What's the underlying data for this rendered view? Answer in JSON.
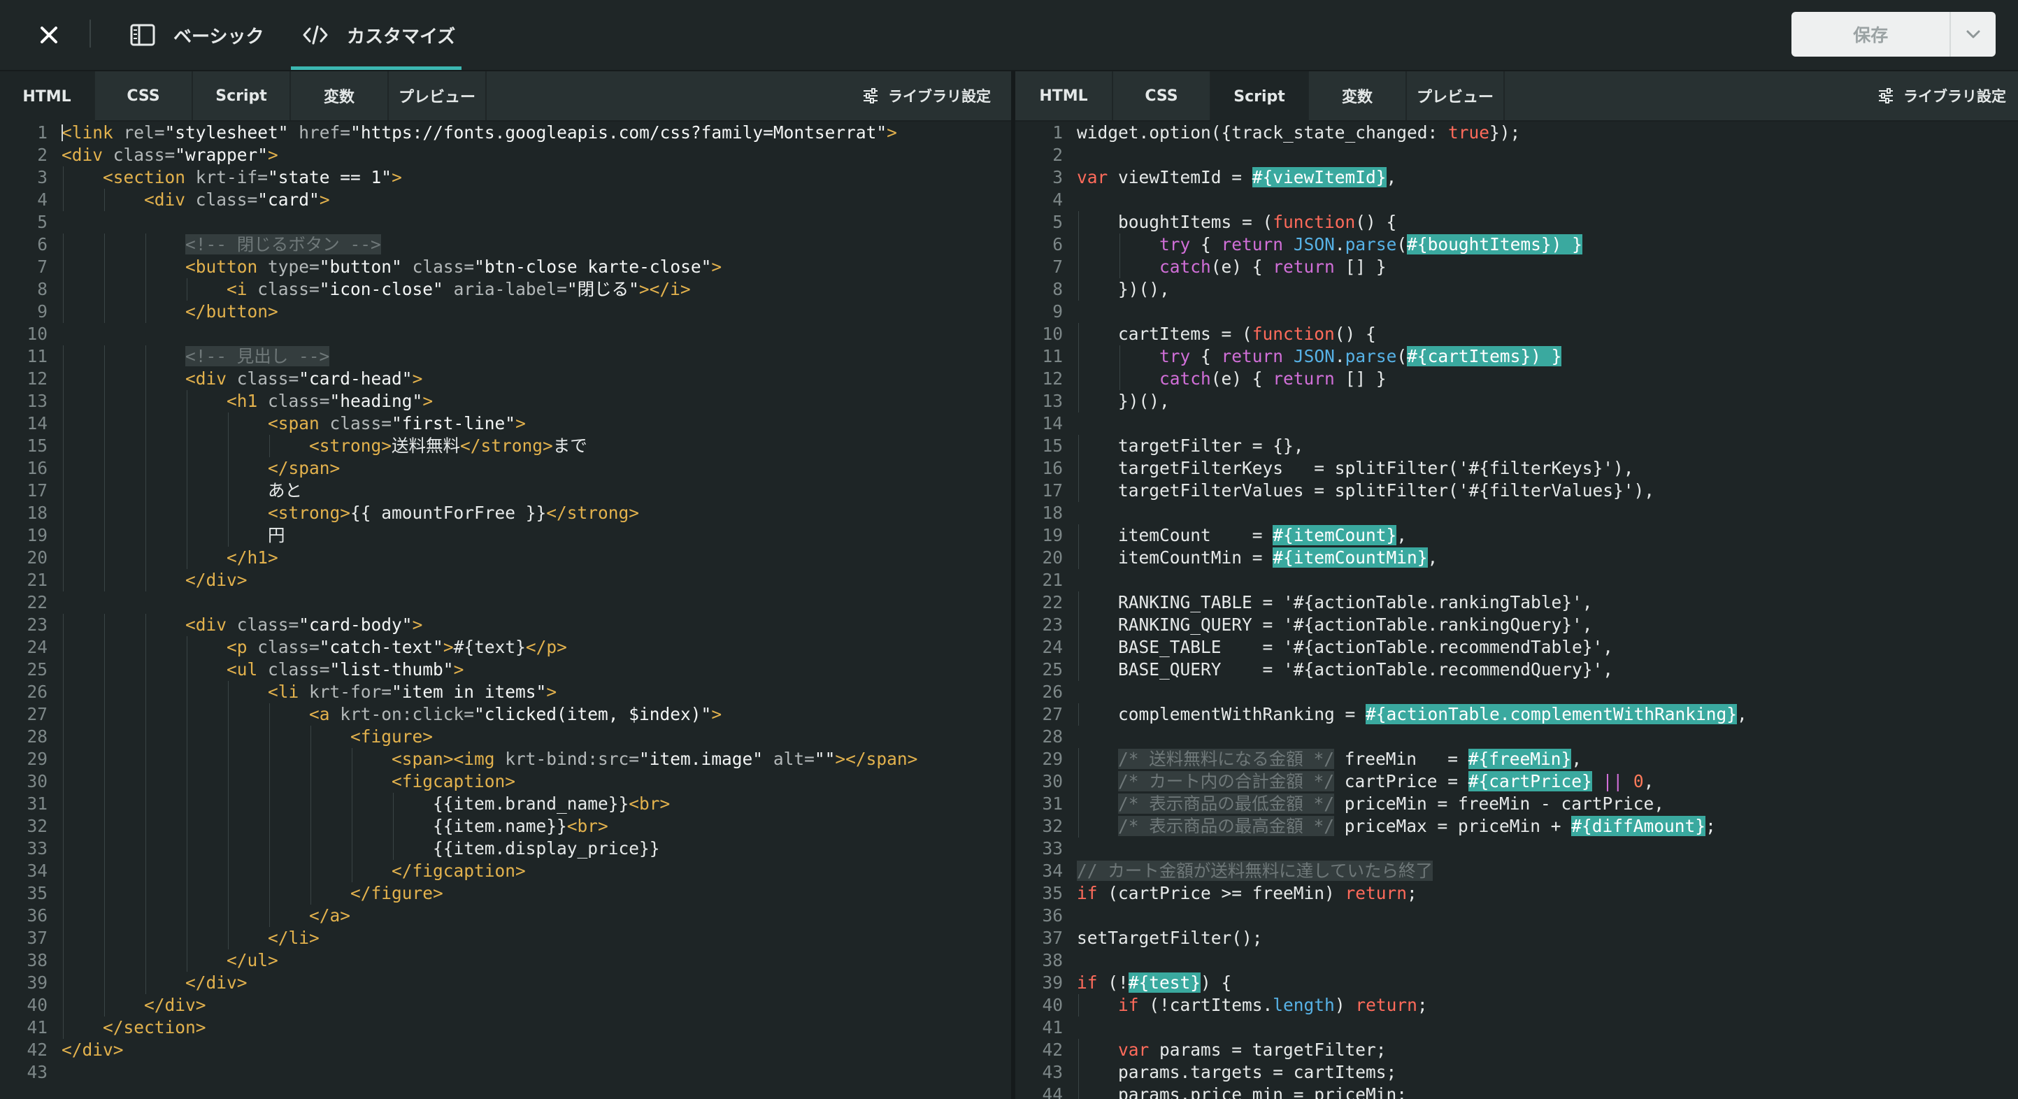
{
  "topbar": {
    "tab_basic": "ベーシック",
    "tab_customize": "カスタマイズ",
    "save_label": "保存"
  },
  "left_pane": {
    "tabs": [
      "HTML",
      "CSS",
      "Script",
      "変数",
      "プレビュー"
    ],
    "active_tab": "HTML",
    "library_label": "ライブラリ設定",
    "lines": [
      [
        [
          "t",
          "<link "
        ],
        [
          "a",
          "rel="
        ],
        [
          "s",
          "\"stylesheet\" "
        ],
        [
          "a",
          "href="
        ],
        [
          "s",
          "\"https://fonts.googleapis.com/css?family=Montserrat\""
        ],
        [
          "t",
          ">"
        ]
      ],
      [
        [
          "t",
          "<div "
        ],
        [
          "a",
          "class="
        ],
        [
          "s",
          "\"wrapper\""
        ],
        [
          "t",
          ">"
        ]
      ],
      [
        [
          "p",
          "    "
        ],
        [
          "t",
          "<section "
        ],
        [
          "a",
          "krt-if="
        ],
        [
          "s",
          "\"state == 1\""
        ],
        [
          "t",
          ">"
        ]
      ],
      [
        [
          "p",
          "        "
        ],
        [
          "t",
          "<div "
        ],
        [
          "a",
          "class="
        ],
        [
          "s",
          "\"card\""
        ],
        [
          "t",
          ">"
        ]
      ],
      [],
      [
        [
          "p",
          "            "
        ],
        [
          "c",
          "<!-- 閉じるボタン -->"
        ]
      ],
      [
        [
          "p",
          "            "
        ],
        [
          "t",
          "<button "
        ],
        [
          "a",
          "type="
        ],
        [
          "s",
          "\"button\" "
        ],
        [
          "a",
          "class="
        ],
        [
          "s",
          "\"btn-close karte-close\""
        ],
        [
          "t",
          ">"
        ]
      ],
      [
        [
          "p",
          "                "
        ],
        [
          "t",
          "<i "
        ],
        [
          "a",
          "class="
        ],
        [
          "s",
          "\"icon-close\" "
        ],
        [
          "a",
          "aria-label="
        ],
        [
          "s",
          "\"閉じる\""
        ],
        [
          "t",
          "></i>"
        ]
      ],
      [
        [
          "p",
          "            "
        ],
        [
          "t",
          "</button>"
        ]
      ],
      [],
      [
        [
          "p",
          "            "
        ],
        [
          "c",
          "<!-- 見出し -->"
        ]
      ],
      [
        [
          "p",
          "            "
        ],
        [
          "t",
          "<div "
        ],
        [
          "a",
          "class="
        ],
        [
          "s",
          "\"card-head\""
        ],
        [
          "t",
          ">"
        ]
      ],
      [
        [
          "p",
          "                "
        ],
        [
          "t",
          "<h1 "
        ],
        [
          "a",
          "class="
        ],
        [
          "s",
          "\"heading\""
        ],
        [
          "t",
          ">"
        ]
      ],
      [
        [
          "p",
          "                    "
        ],
        [
          "t",
          "<span "
        ],
        [
          "a",
          "class="
        ],
        [
          "s",
          "\"first-line\""
        ],
        [
          "t",
          ">"
        ]
      ],
      [
        [
          "p",
          "                        "
        ],
        [
          "t",
          "<strong>"
        ],
        [
          "n",
          "送料無料"
        ],
        [
          "t",
          "</strong>"
        ],
        [
          "n",
          "まで"
        ]
      ],
      [
        [
          "p",
          "                    "
        ],
        [
          "t",
          "</span>"
        ]
      ],
      [
        [
          "p",
          "                    "
        ],
        [
          "n",
          "あと"
        ]
      ],
      [
        [
          "p",
          "                    "
        ],
        [
          "t",
          "<strong>"
        ],
        [
          "n",
          "{{ amountForFree }}"
        ],
        [
          "t",
          "</strong>"
        ]
      ],
      [
        [
          "p",
          "                    "
        ],
        [
          "n",
          "円"
        ]
      ],
      [
        [
          "p",
          "                "
        ],
        [
          "t",
          "</h1>"
        ]
      ],
      [
        [
          "p",
          "            "
        ],
        [
          "t",
          "</div>"
        ]
      ],
      [],
      [
        [
          "p",
          "            "
        ],
        [
          "t",
          "<div "
        ],
        [
          "a",
          "class="
        ],
        [
          "s",
          "\"card-body\""
        ],
        [
          "t",
          ">"
        ]
      ],
      [
        [
          "p",
          "                "
        ],
        [
          "t",
          "<p "
        ],
        [
          "a",
          "class="
        ],
        [
          "s",
          "\"catch-text\""
        ],
        [
          "t",
          ">"
        ],
        [
          "n",
          "#{text}"
        ],
        [
          "t",
          "</p>"
        ]
      ],
      [
        [
          "p",
          "                "
        ],
        [
          "t",
          "<ul "
        ],
        [
          "a",
          "class="
        ],
        [
          "s",
          "\"list-thumb\""
        ],
        [
          "t",
          ">"
        ]
      ],
      [
        [
          "p",
          "                    "
        ],
        [
          "t",
          "<li "
        ],
        [
          "a",
          "krt-for="
        ],
        [
          "s",
          "\"item in items\""
        ],
        [
          "t",
          ">"
        ]
      ],
      [
        [
          "p",
          "                        "
        ],
        [
          "t",
          "<a "
        ],
        [
          "a",
          "krt-on:click="
        ],
        [
          "s",
          "\"clicked(item, $index)\""
        ],
        [
          "t",
          ">"
        ]
      ],
      [
        [
          "p",
          "                            "
        ],
        [
          "t",
          "<figure>"
        ]
      ],
      [
        [
          "p",
          "                                "
        ],
        [
          "t",
          "<span><img "
        ],
        [
          "a",
          "krt-bind:src="
        ],
        [
          "s",
          "\"item.image\" "
        ],
        [
          "a",
          "alt="
        ],
        [
          "s",
          "\"\""
        ],
        [
          "t",
          "></span>"
        ]
      ],
      [
        [
          "p",
          "                                "
        ],
        [
          "t",
          "<figcaption>"
        ]
      ],
      [
        [
          "p",
          "                                    "
        ],
        [
          "n",
          "{{item.brand_name}}"
        ],
        [
          "t",
          "<br>"
        ]
      ],
      [
        [
          "p",
          "                                    "
        ],
        [
          "n",
          "{{item.name}}"
        ],
        [
          "t",
          "<br>"
        ]
      ],
      [
        [
          "p",
          "                                    "
        ],
        [
          "n",
          "{{item.display_price}}"
        ]
      ],
      [
        [
          "p",
          "                                "
        ],
        [
          "t",
          "</figcaption>"
        ]
      ],
      [
        [
          "p",
          "                            "
        ],
        [
          "t",
          "</figure>"
        ]
      ],
      [
        [
          "p",
          "                        "
        ],
        [
          "t",
          "</a>"
        ]
      ],
      [
        [
          "p",
          "                    "
        ],
        [
          "t",
          "</li>"
        ]
      ],
      [
        [
          "p",
          "                "
        ],
        [
          "t",
          "</ul>"
        ]
      ],
      [
        [
          "p",
          "            "
        ],
        [
          "t",
          "</div>"
        ]
      ],
      [
        [
          "p",
          "        "
        ],
        [
          "t",
          "</div>"
        ]
      ],
      [
        [
          "p",
          "    "
        ],
        [
          "t",
          "</section>"
        ]
      ],
      [
        [
          "t",
          "</div>"
        ]
      ],
      []
    ]
  },
  "right_pane": {
    "tabs": [
      "HTML",
      "CSS",
      "Script",
      "変数",
      "プレビュー"
    ],
    "active_tab": "Script",
    "library_label": "ライブラリ設定",
    "lines": [
      [
        [
          "n",
          "widget.option({track_state_changed: "
        ],
        [
          "k",
          "true"
        ],
        [
          "n",
          "});"
        ]
      ],
      [],
      [
        [
          "k",
          "var "
        ],
        [
          "n",
          "viewItemId = "
        ],
        [
          "h",
          "#{viewItemId}"
        ],
        [
          "n",
          ","
        ]
      ],
      [],
      [
        [
          "p",
          "    "
        ],
        [
          "n",
          "boughtItems = ("
        ],
        [
          "k",
          "function"
        ],
        [
          "n",
          "() {"
        ]
      ],
      [
        [
          "p",
          "        "
        ],
        [
          "u",
          "try "
        ],
        [
          "n",
          "{ "
        ],
        [
          "u",
          "return "
        ],
        [
          "b",
          "JSON"
        ],
        [
          "n",
          "."
        ],
        [
          "b",
          "parse"
        ],
        [
          "n",
          "("
        ],
        [
          "h",
          "#{boughtItems}) }"
        ]
      ],
      [
        [
          "p",
          "        "
        ],
        [
          "u",
          "catch"
        ],
        [
          "n",
          "(e) { "
        ],
        [
          "u",
          "return "
        ],
        [
          "n",
          "[] }"
        ]
      ],
      [
        [
          "p",
          "    "
        ],
        [
          "n",
          "})(),"
        ]
      ],
      [],
      [
        [
          "p",
          "    "
        ],
        [
          "n",
          "cartItems = ("
        ],
        [
          "k",
          "function"
        ],
        [
          "n",
          "() {"
        ]
      ],
      [
        [
          "p",
          "        "
        ],
        [
          "u",
          "try "
        ],
        [
          "n",
          "{ "
        ],
        [
          "u",
          "return "
        ],
        [
          "b",
          "JSON"
        ],
        [
          "n",
          "."
        ],
        [
          "b",
          "parse"
        ],
        [
          "n",
          "("
        ],
        [
          "h",
          "#{cartItems}) }"
        ]
      ],
      [
        [
          "p",
          "        "
        ],
        [
          "u",
          "catch"
        ],
        [
          "n",
          "(e) { "
        ],
        [
          "u",
          "return "
        ],
        [
          "n",
          "[] }"
        ]
      ],
      [
        [
          "p",
          "    "
        ],
        [
          "n",
          "})(),"
        ]
      ],
      [],
      [
        [
          "p",
          "    "
        ],
        [
          "n",
          "targetFilter = {},"
        ]
      ],
      [
        [
          "p",
          "    "
        ],
        [
          "n",
          "targetFilterKeys   = splitFilter('#{filterKeys}'),"
        ]
      ],
      [
        [
          "p",
          "    "
        ],
        [
          "n",
          "targetFilterValues = splitFilter('#{filterValues}'),"
        ]
      ],
      [],
      [
        [
          "p",
          "    "
        ],
        [
          "n",
          "itemCount    = "
        ],
        [
          "h",
          "#{itemCount}"
        ],
        [
          "n",
          ","
        ]
      ],
      [
        [
          "p",
          "    "
        ],
        [
          "n",
          "itemCountMin = "
        ],
        [
          "h",
          "#{itemCountMin}"
        ],
        [
          "n",
          ","
        ]
      ],
      [],
      [
        [
          "p",
          "    "
        ],
        [
          "n",
          "RANKING_TABLE = '#{actionTable.rankingTable}',"
        ]
      ],
      [
        [
          "p",
          "    "
        ],
        [
          "n",
          "RANKING_QUERY = '#{actionTable.rankingQuery}',"
        ]
      ],
      [
        [
          "p",
          "    "
        ],
        [
          "n",
          "BASE_TABLE    = '#{actionTable.recommendTable}',"
        ]
      ],
      [
        [
          "p",
          "    "
        ],
        [
          "n",
          "BASE_QUERY    = '#{actionTable.recommendQuery}',"
        ]
      ],
      [],
      [
        [
          "p",
          "    "
        ],
        [
          "n",
          "complementWithRanking = "
        ],
        [
          "h",
          "#{actionTable.complementWithRanking}"
        ],
        [
          "n",
          ","
        ]
      ],
      [],
      [
        [
          "p",
          "    "
        ],
        [
          "c",
          "/* 送料無料になる金額 */"
        ],
        [
          "n",
          " freeMin   = "
        ],
        [
          "h",
          "#{freeMin}"
        ],
        [
          "n",
          ","
        ]
      ],
      [
        [
          "p",
          "    "
        ],
        [
          "c",
          "/* カート内の合計金額 */"
        ],
        [
          "n",
          " cartPrice = "
        ],
        [
          "h",
          "#{cartPrice}"
        ],
        [
          "n",
          " "
        ],
        [
          "u",
          "||"
        ],
        [
          "n",
          " "
        ],
        [
          "m",
          "0"
        ],
        [
          "n",
          ","
        ]
      ],
      [
        [
          "p",
          "    "
        ],
        [
          "c",
          "/* 表示商品の最低金額 */"
        ],
        [
          "n",
          " priceMin = freeMin - cartPrice,"
        ]
      ],
      [
        [
          "p",
          "    "
        ],
        [
          "c",
          "/* 表示商品の最高金額 */"
        ],
        [
          "n",
          " priceMax = priceMin + "
        ],
        [
          "h",
          "#{diffAmount}"
        ],
        [
          "n",
          ";"
        ]
      ],
      [],
      [
        [
          "c",
          "// カート金額が送料無料に達していたら終了"
        ]
      ],
      [
        [
          "k",
          "if "
        ],
        [
          "n",
          "(cartPrice >= freeMin) "
        ],
        [
          "k",
          "return"
        ],
        [
          "n",
          ";"
        ]
      ],
      [],
      [
        [
          "n",
          "setTargetFilter();"
        ]
      ],
      [],
      [
        [
          "k",
          "if "
        ],
        [
          "n",
          "(!"
        ],
        [
          "h",
          "#{test}"
        ],
        [
          "n",
          ") {"
        ]
      ],
      [
        [
          "p",
          "    "
        ],
        [
          "k",
          "if "
        ],
        [
          "n",
          "(!cartItems."
        ],
        [
          "b",
          "length"
        ],
        [
          "n",
          ") "
        ],
        [
          "k",
          "return"
        ],
        [
          "n",
          ";"
        ]
      ],
      [],
      [
        [
          "p",
          "    "
        ],
        [
          "k",
          "var "
        ],
        [
          "n",
          "params = targetFilter;"
        ]
      ],
      [
        [
          "p",
          "    "
        ],
        [
          "n",
          "params.targets = cartItems;"
        ]
      ],
      [
        [
          "p",
          "    "
        ],
        [
          "n",
          "params.price_min = priceMin;"
        ]
      ]
    ]
  }
}
